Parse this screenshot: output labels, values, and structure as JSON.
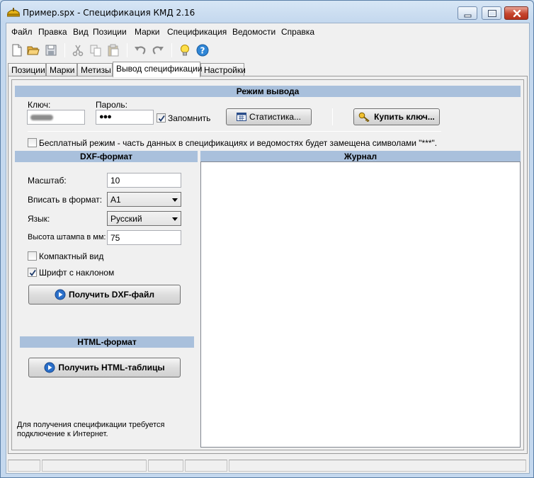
{
  "window": {
    "title": "Пример.spx - Спецификация КМД 2.16"
  },
  "menu": [
    "Файл",
    "Правка",
    "Вид",
    "Позиции",
    "Марки",
    "Спецификация",
    "Ведомости",
    "Справка"
  ],
  "toolbar": {
    "icons": [
      "new-file-icon",
      "open-folder-icon",
      "save-icon",
      "cut-icon",
      "copy-icon",
      "paste-icon",
      "undo-icon",
      "redo-icon",
      "tip-bulb-icon",
      "help-icon"
    ]
  },
  "tabs": [
    "Позиции",
    "Марки",
    "Метизы",
    "Вывод спецификации",
    "Настройки"
  ],
  "active_tab": 3,
  "output_mode": {
    "heading": "Режим вывода",
    "key_label": "Ключ:",
    "password_label": "Пароль:",
    "password_value": "●●●",
    "remember_label": "Запомнить",
    "remember_checked": true,
    "stats_button": "Статистика...",
    "buy_key_button": "Купить ключ...",
    "free_mode_label": "Бесплатный режим - часть данных в спецификациях и ведомостях будет замещена символами \"***\".",
    "free_mode_checked": false
  },
  "dxf": {
    "heading": "DXF-формат",
    "scale_label": "Масштаб:",
    "scale_value": "10",
    "fit_label": "Вписать в формат:",
    "fit_value": "A1",
    "lang_label": "Язык:",
    "lang_value": "Русский",
    "stamp_label": "Высота штампа в мм:",
    "stamp_value": "75",
    "compact_label": "Компактный вид",
    "compact_checked": false,
    "italic_label": "Шрифт с наклоном",
    "italic_checked": true,
    "get_button": "Получить DXF-файл"
  },
  "html": {
    "heading": "HTML-формат",
    "get_button": "Получить HTML-таблицы"
  },
  "note": {
    "line1": "Для получения спецификации требуется",
    "line2": "подключение к Интернет."
  },
  "journal": {
    "heading": "Журнал"
  },
  "colors": {
    "section_header": "#a9c0dc",
    "title_bar": "#c4d8ee",
    "close_button": "#c6452e"
  }
}
